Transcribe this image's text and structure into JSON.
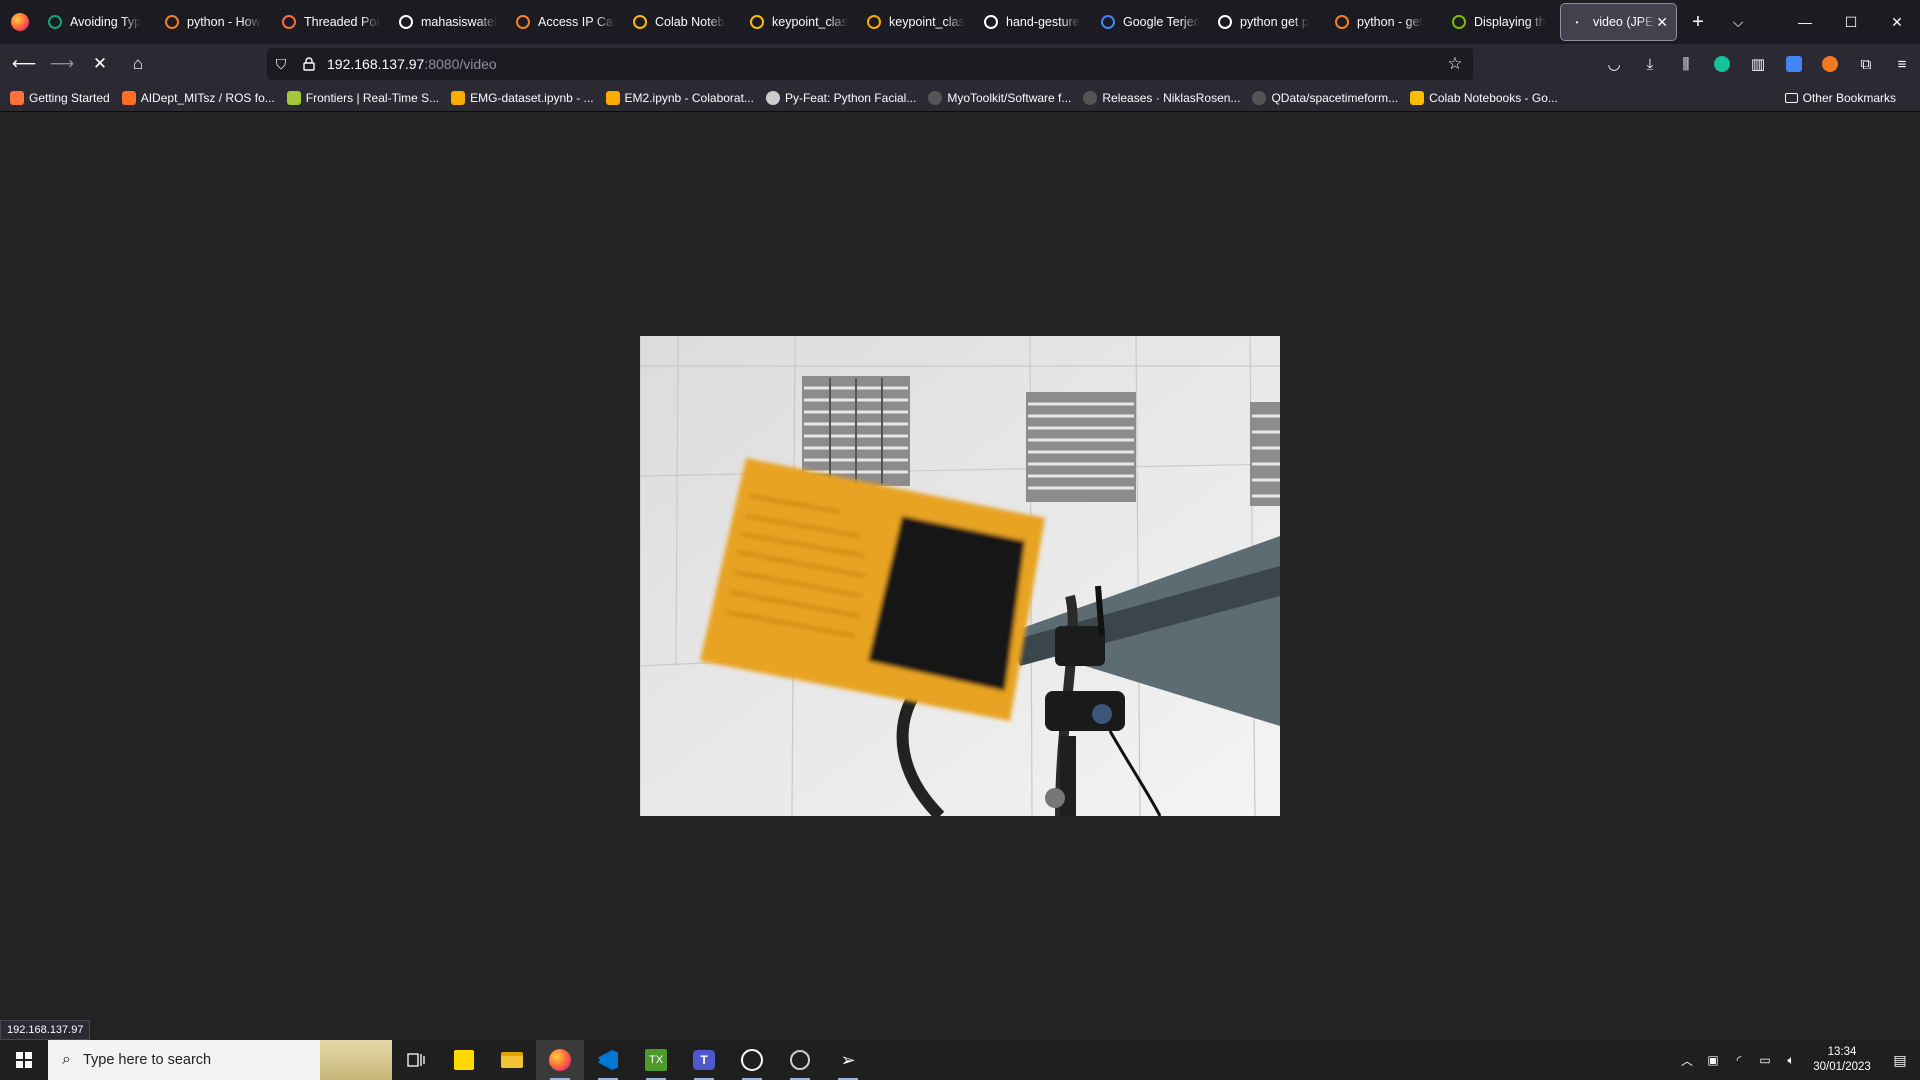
{
  "tabs": [
    {
      "label": "Avoiding Typ",
      "icon": "openai-icon",
      "color": "#10a37f"
    },
    {
      "label": "python - How",
      "icon": "stackoverflow-icon",
      "color": "#f48024"
    },
    {
      "label": "Threaded Por",
      "icon": "pin-icon",
      "color": "#ff6a3d"
    },
    {
      "label": "mahasiswatel",
      "icon": "github-icon",
      "color": "#ffffff"
    },
    {
      "label": "Access IP Can",
      "icon": "stackoverflow-icon",
      "color": "#f48024"
    },
    {
      "label": "Colab Noteb",
      "icon": "drive-icon",
      "color": "#fbbc04"
    },
    {
      "label": "keypoint_clas",
      "icon": "drive-icon",
      "color": "#fbbc04"
    },
    {
      "label": "keypoint_clas",
      "icon": "colab-icon",
      "color": "#f9ab00"
    },
    {
      "label": "hand-gesture",
      "icon": "github-icon",
      "color": "#ffffff"
    },
    {
      "label": "Google Terjem",
      "icon": "translate-icon",
      "color": "#4285f4"
    },
    {
      "label": "python get p",
      "icon": "google-icon",
      "color": "#ffffff"
    },
    {
      "label": "python - get",
      "icon": "stackoverflow-icon",
      "color": "#f48024"
    },
    {
      "label": "Displaying th",
      "icon": "link-icon",
      "color": "#7fba00"
    }
  ],
  "active_tab": {
    "label": "video (JPEG",
    "close": "✕"
  },
  "url": {
    "host": "192.168.137.97",
    "path": ":8080/video"
  },
  "bookmarks": [
    {
      "label": "Getting Started",
      "icon": "firefox-icon",
      "color": "#ff7139"
    },
    {
      "label": "AIDept_MITsz / ROS fo...",
      "icon": "gitlab-icon",
      "color": "#fc6d26"
    },
    {
      "label": "Frontiers | Real-Time S...",
      "icon": "frontiers-icon",
      "color": "#a4c639"
    },
    {
      "label": "EMG-dataset.ipynb - ...",
      "icon": "colab-icon",
      "color": "#f9ab00"
    },
    {
      "label": "EM2.ipynb - Colaborat...",
      "icon": "colab-icon",
      "color": "#f9ab00"
    },
    {
      "label": "Py-Feat: Python Facial...",
      "icon": "globe-icon",
      "color": "#cccccc"
    },
    {
      "label": "MyoToolkit/Software f...",
      "icon": "github-icon",
      "color": "#555555"
    },
    {
      "label": "Releases · NiklasRosen...",
      "icon": "github-icon",
      "color": "#555555"
    },
    {
      "label": "QData/spacetimeform...",
      "icon": "github-icon",
      "color": "#555555"
    },
    {
      "label": "Colab Notebooks - Go...",
      "icon": "drive-icon",
      "color": "#fbbc04"
    }
  ],
  "other_bookmarks": "Other Bookmarks",
  "status_text": "192.168.137.97",
  "taskbar": {
    "search_placeholder": "Type here to search",
    "time": "13:34",
    "date": "30/01/2023"
  },
  "colors": {
    "accent": "#ff7139",
    "content_bg": "#232323",
    "sticky_note": "#ffd900"
  }
}
